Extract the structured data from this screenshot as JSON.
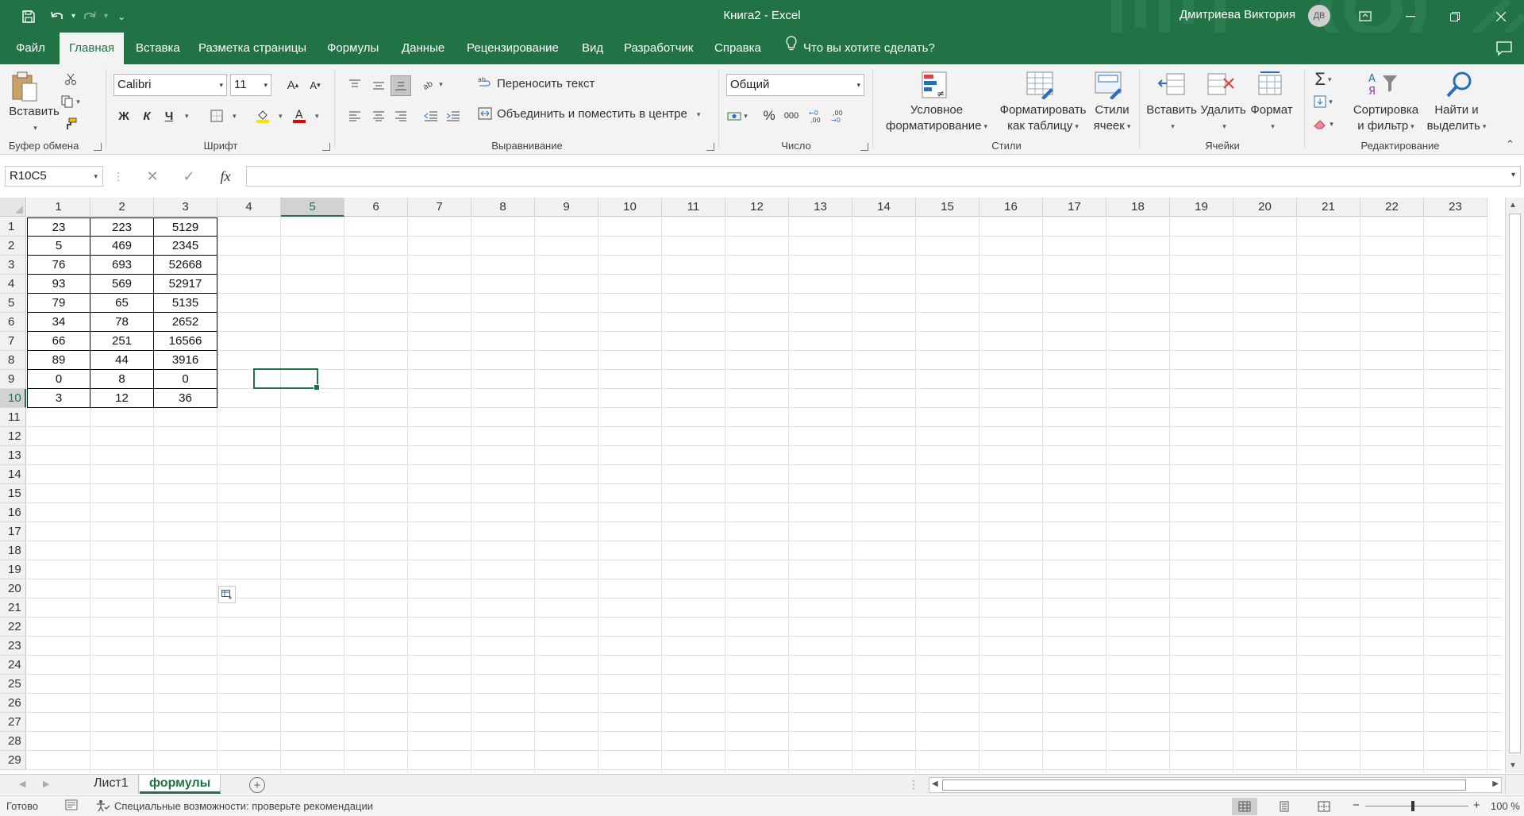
{
  "window": {
    "title": "Книга2  -  Excel",
    "user": "Дмитриева Виктория",
    "avatar_initials": "ДВ"
  },
  "tabs": [
    {
      "label": "Файл"
    },
    {
      "label": "Главная"
    },
    {
      "label": "Вставка"
    },
    {
      "label": "Разметка страницы"
    },
    {
      "label": "Формулы"
    },
    {
      "label": "Данные"
    },
    {
      "label": "Рецензирование"
    },
    {
      "label": "Вид"
    },
    {
      "label": "Разработчик"
    },
    {
      "label": "Справка"
    },
    {
      "label": "Что вы хотите сделать?"
    }
  ],
  "ribbon": {
    "clipboard": {
      "paste": "Вставить",
      "group": "Буфер обмена"
    },
    "font": {
      "name": "Calibri",
      "size": "11",
      "bold": "Ж",
      "italic": "К",
      "underline": "Ч",
      "group": "Шрифт"
    },
    "alignment": {
      "wrap": "Переносить текст",
      "merge": "Объединить и поместить в центре",
      "group": "Выравнивание"
    },
    "number": {
      "format": "Общий",
      "percent": "%",
      "thousands": "000",
      "group": "Число"
    },
    "styles": {
      "conditional_1": "Условное",
      "conditional_2": "форматирование",
      "table_1": "Форматировать",
      "table_2": "как таблицу",
      "cell_1": "Стили",
      "cell_2": "ячеек",
      "group": "Стили"
    },
    "cells": {
      "insert": "Вставить",
      "delete": "Удалить",
      "format": "Формат",
      "group": "Ячейки"
    },
    "editing": {
      "sort_1": "Сортировка",
      "sort_2": "и фильтр",
      "find_1": "Найти и",
      "find_2": "выделить",
      "group": "Редактирование"
    }
  },
  "formula_bar": {
    "name_box": "R10C5",
    "fx": "fx",
    "value": ""
  },
  "grid": {
    "columns": [
      "1",
      "2",
      "3",
      "4",
      "5",
      "6",
      "7",
      "8",
      "9",
      "10",
      "11",
      "12",
      "13",
      "14",
      "15",
      "16",
      "17",
      "18",
      "19",
      "20",
      "21",
      "22",
      "23"
    ],
    "rows": [
      "1",
      "2",
      "3",
      "4",
      "5",
      "6",
      "7",
      "8",
      "9",
      "10",
      "11",
      "12",
      "13",
      "14",
      "15",
      "16",
      "17",
      "18",
      "19",
      "20",
      "21",
      "22",
      "23",
      "24",
      "25",
      "26",
      "27",
      "28",
      "29"
    ],
    "data": [
      [
        "23",
        "223",
        "5129"
      ],
      [
        "5",
        "469",
        "2345"
      ],
      [
        "76",
        "693",
        "52668"
      ],
      [
        "93",
        "569",
        "52917"
      ],
      [
        "79",
        "65",
        "5135"
      ],
      [
        "34",
        "78",
        "2652"
      ],
      [
        "66",
        "251",
        "16566"
      ],
      [
        "89",
        "44",
        "3916"
      ],
      [
        "0",
        "8",
        "0"
      ],
      [
        "3",
        "12",
        "36"
      ]
    ],
    "selected_row": "10",
    "selected_col": "5"
  },
  "sheets": [
    {
      "label": "Лист1"
    },
    {
      "label": "формулы"
    }
  ],
  "status": {
    "ready": "Готово",
    "accessibility": "Специальные возможности: проверьте рекомендации",
    "zoom": "100 %"
  },
  "colors": {
    "accent": "#217346",
    "ribbon": "#f3f3f3"
  }
}
